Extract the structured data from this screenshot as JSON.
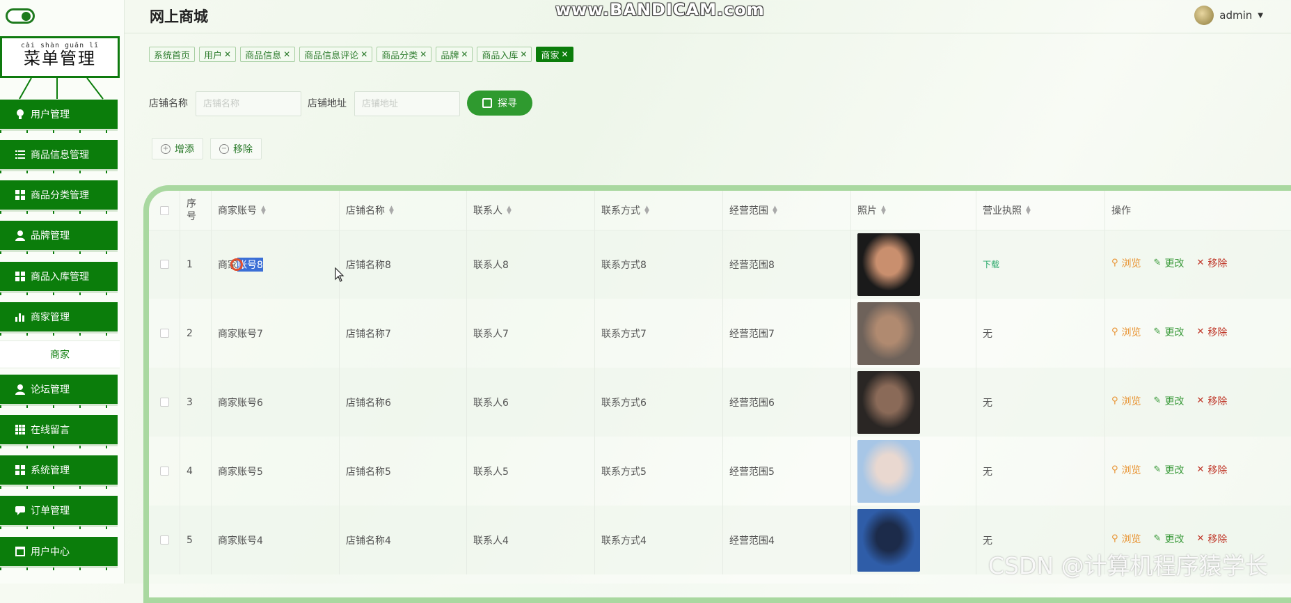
{
  "app": {
    "title": "网上商城",
    "recording_watermark": "www.BANDICAM.com",
    "csdn_watermark": "CSDN @计算机程序猿学长"
  },
  "user": {
    "name": "admin"
  },
  "sidebar": {
    "title_pinyin": "cài shàn guǎn lǐ",
    "title": "菜单管理",
    "items": [
      {
        "label": "用户管理",
        "icon": "lightbulb-icon"
      },
      {
        "label": "商品信息管理",
        "icon": "list-icon"
      },
      {
        "label": "商品分类管理",
        "icon": "grid-icon"
      },
      {
        "label": "品牌管理",
        "icon": "user-icon"
      },
      {
        "label": "商品入库管理",
        "icon": "grid-icon"
      },
      {
        "label": "商家管理",
        "icon": "bar-chart-icon"
      },
      {
        "label": "论坛管理",
        "icon": "user-icon"
      },
      {
        "label": "在线留言",
        "icon": "grid9-icon"
      },
      {
        "label": "系统管理",
        "icon": "grid-icon"
      },
      {
        "label": "订单管理",
        "icon": "comment-icon"
      },
      {
        "label": "用户中心",
        "icon": "window-icon"
      }
    ],
    "active_sub": "商家"
  },
  "tabs": [
    {
      "label": "系统首页",
      "closable": false
    },
    {
      "label": "用户",
      "closable": true
    },
    {
      "label": "商品信息",
      "closable": true
    },
    {
      "label": "商品信息评论",
      "closable": true
    },
    {
      "label": "商品分类",
      "closable": true
    },
    {
      "label": "品牌",
      "closable": true
    },
    {
      "label": "商品入库",
      "closable": true
    },
    {
      "label": "商家",
      "closable": true,
      "active": true
    }
  ],
  "search": {
    "shop_name_label": "店铺名称",
    "shop_name_placeholder": "店铺名称",
    "shop_addr_label": "店铺地址",
    "shop_addr_placeholder": "店铺地址",
    "button": "探寻"
  },
  "actions": {
    "add": "增添",
    "remove": "移除"
  },
  "table": {
    "headers": [
      "序号",
      "商家账号",
      "店铺名称",
      "联系人",
      "联系方式",
      "经营范围",
      "照片",
      "营业执照",
      "操作"
    ],
    "ops": {
      "view": "浏览",
      "edit": "更改",
      "delete": "移除"
    },
    "rows": [
      {
        "no": "1",
        "account": "商家账号8",
        "shop": "店铺名称8",
        "contact": "联系人8",
        "phone": "联系方式8",
        "scope": "经营范围8",
        "license": "下载",
        "photo": [
          "#1a1a1a",
          "#c98f6e"
        ]
      },
      {
        "no": "2",
        "account": "商家账号7",
        "shop": "店铺名称7",
        "contact": "联系人7",
        "phone": "联系方式7",
        "scope": "经营范围7",
        "license": "无",
        "photo": [
          "#6e625a",
          "#b08a70"
        ]
      },
      {
        "no": "3",
        "account": "商家账号6",
        "shop": "店铺名称6",
        "contact": "联系人6",
        "phone": "联系方式6",
        "scope": "经营范围6",
        "license": "无",
        "photo": [
          "#2a2624",
          "#8a6a58"
        ]
      },
      {
        "no": "4",
        "account": "商家账号5",
        "shop": "店铺名称5",
        "contact": "联系人5",
        "phone": "联系方式5",
        "scope": "经营范围5",
        "license": "无",
        "photo": [
          "#a7c6e6",
          "#e9d8d0"
        ]
      },
      {
        "no": "5",
        "account": "商家账号4",
        "shop": "店铺名称4",
        "contact": "联系人4",
        "phone": "联系方式4",
        "scope": "经营范围4",
        "license": "无",
        "photo": [
          "#2f5da8",
          "#1c2b4a"
        ]
      }
    ]
  },
  "colors": {
    "primary": "#0b7d0b",
    "accent_button": "#2f9a2f",
    "frame": "#a9d8a0",
    "view": "#e8912e",
    "edit": "#3a9a3a",
    "delete": "#c0392b"
  }
}
